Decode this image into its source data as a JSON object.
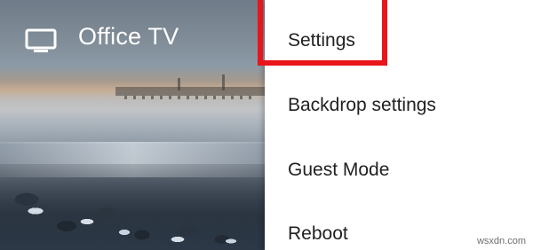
{
  "header": {
    "icon": "tv-icon",
    "title": "Office TV"
  },
  "menu": {
    "items": [
      {
        "label": "Settings"
      },
      {
        "label": "Backdrop settings"
      },
      {
        "label": "Guest Mode"
      },
      {
        "label": "Reboot"
      }
    ]
  },
  "annotation": {
    "highlight_color": "#e8161b",
    "highlighted_item": "Settings"
  },
  "watermark": "wsxdn.com"
}
